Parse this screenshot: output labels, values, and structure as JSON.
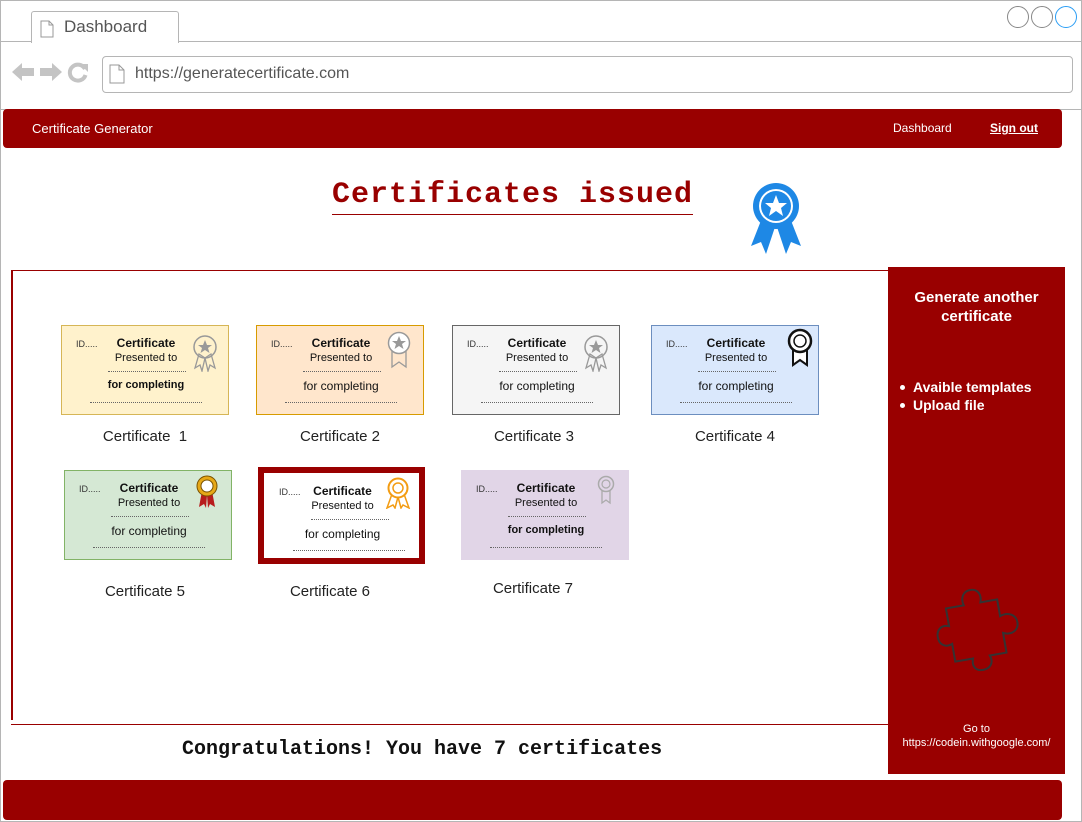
{
  "browser": {
    "tab_title": "Dashboard",
    "url": "https://generatecertificate.com"
  },
  "header": {
    "brand": "Certificate Generator",
    "nav_dashboard": "Dashboard",
    "nav_signout": "Sign out"
  },
  "page": {
    "title": "Certificates issued",
    "congrats": "Congratulations! You have 7 certificates"
  },
  "certificates": [
    {
      "label": "Certificate  1",
      "id": "ID.....",
      "title": "Certificate",
      "presented": "Presented to",
      "completing": "for completing",
      "bg": "#fff2cc",
      "border": "#d6b656",
      "medal": "star-medal-icon",
      "selected": false
    },
    {
      "label": "Certificate 2",
      "id": "ID.....",
      "title": "Certificate",
      "presented": "Presented to",
      "completing": "for completing",
      "bg": "#ffe6cc",
      "border": "#d79b00",
      "medal": "star-ribbon-icon",
      "selected": false
    },
    {
      "label": "Certificate 3",
      "id": "ID.....",
      "title": "Certificate",
      "presented": "Presented to",
      "completing": "for completing",
      "bg": "#f5f5f5",
      "border": "#666666",
      "medal": "star-medal-icon",
      "selected": false
    },
    {
      "label": "Certificate 4",
      "id": "ID.....",
      "title": "Certificate",
      "presented": "Presented to",
      "completing": "for completing",
      "bg": "#dae8fc",
      "border": "#6c8ebf",
      "medal": "award-ribbon-icon",
      "selected": false
    },
    {
      "label": "Certificate 5",
      "id": "ID.....",
      "title": "Certificate",
      "presented": "Presented to",
      "completing": "for completing",
      "bg": "#d5e8d4",
      "border": "#82b366",
      "medal": "rosette-icon",
      "selected": false
    },
    {
      "label": "Certificate 6",
      "id": "ID.....",
      "title": "Certificate",
      "presented": "Presented to",
      "completing": "for completing",
      "bg": "#ffffff",
      "border": "#ffffff",
      "medal": "rosette-gold-icon",
      "selected": true
    },
    {
      "label": "Certificate 7",
      "id": "ID.....",
      "title": "Certificate",
      "presented": "Presented to",
      "completing": "for completing",
      "bg": "#e1d5e7",
      "border": "#e1d5e7",
      "medal": "ribbon-outline-icon",
      "selected": false
    }
  ],
  "side_panel": {
    "title": "Generate another certificate",
    "items": [
      "Avaible templates",
      "Upload file"
    ],
    "goto_label": "Go to",
    "goto_url": "https://codein.withgoogle.com/"
  },
  "colors": {
    "brand": "#990000",
    "badge": "#1e88e5"
  }
}
